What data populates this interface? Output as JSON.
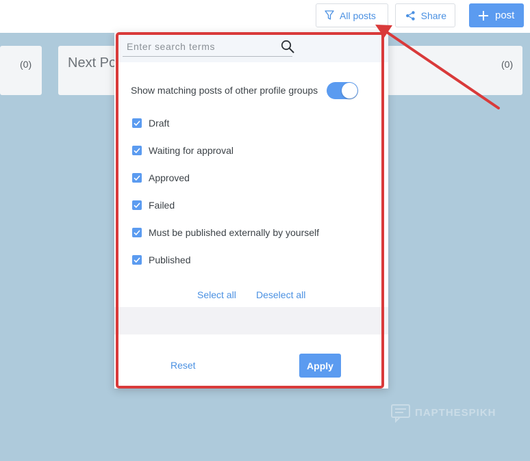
{
  "toolbar": {
    "filter_label": "All posts",
    "share_label": "Share",
    "post_label": "post"
  },
  "cards": {
    "left_count": "(0)",
    "mid_title": "Next Po",
    "right_count": "(0)"
  },
  "filter_panel": {
    "search_placeholder": "Enter search terms",
    "search_value": "",
    "toggle_label": "Show matching posts of other profile groups",
    "toggle_on": true,
    "statuses": [
      {
        "label": "Draft",
        "checked": true
      },
      {
        "label": "Waiting for approval",
        "checked": true
      },
      {
        "label": "Approved",
        "checked": true
      },
      {
        "label": "Failed",
        "checked": true
      },
      {
        "label": "Must be published externally by yourself",
        "checked": true
      },
      {
        "label": "Published",
        "checked": true
      }
    ],
    "select_all": "Select all",
    "deselect_all": "Deselect all",
    "reset": "Reset",
    "apply": "Apply"
  },
  "watermark": {
    "text": "ΠΑΡΤΗΕSΡΙΚΗ"
  },
  "colors": {
    "accent": "#5b9bf0",
    "link": "#4a90e2",
    "background": "#aecadb",
    "annotation": "#d93a3a"
  },
  "icons": [
    "filter-icon",
    "share-icon",
    "plus-icon",
    "search-icon",
    "checkbox-checked-icon"
  ]
}
